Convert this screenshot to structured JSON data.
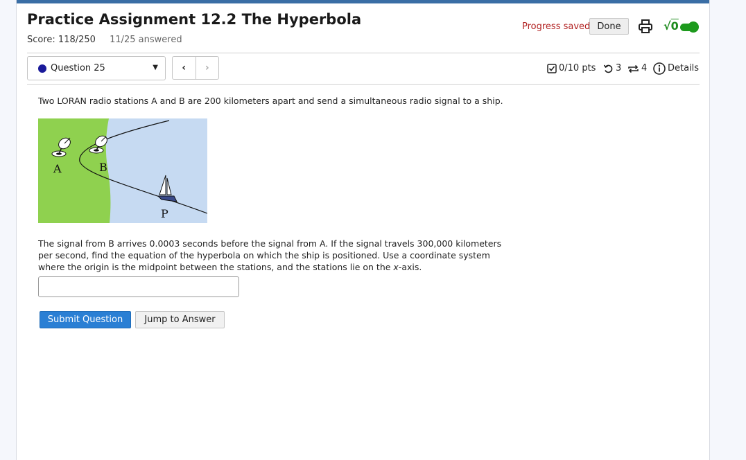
{
  "assignment": {
    "title": "Practice Assignment 12.2 The Hyperbola",
    "score": "Score: 118/250",
    "answered": "11/25 answered"
  },
  "header": {
    "progress_status": "Progress saved",
    "done_label": "Done",
    "print_icon": "printer-icon",
    "math_icon_symbol": "√",
    "math_icon_radicand": "0"
  },
  "question_nav": {
    "selected": "Question 25",
    "prev_symbol": "‹",
    "next_symbol": "›"
  },
  "question_meta": {
    "points": "0/10 pts",
    "retries": "3",
    "attempts": "4",
    "details_label": "Details"
  },
  "question": {
    "intro": "Two LORAN radio stations A and B are 200 kilometers apart and send a simultaneous radio signal to a ship.",
    "figure_labels": {
      "station_a": "A",
      "station_b": "B",
      "ship": "P"
    },
    "body_line_1": "The signal from B arrives 0.0003 seconds before the signal from A. If the signal travels 300,000 kilometers",
    "body_line_2": "per second, find the equation of the hyperbola on which the ship is positioned. Use a coordinate system",
    "body_line_3_before": "where the origin is the midpoint between the stations, and the stations lie on the ",
    "body_line_3_var": "x",
    "body_line_3_after": "-axis.",
    "answer_value": ""
  },
  "actions": {
    "submit_label": "Submit Question",
    "jump_label": "Jump to Answer"
  },
  "colors": {
    "accent_blue": "#2a7fd4",
    "top_bar": "#3a6ea5",
    "saved_red": "#b22222",
    "toggle_green": "#1d9a1d",
    "land_green": "#8fd14f",
    "sea_blue": "#c6daf2"
  }
}
